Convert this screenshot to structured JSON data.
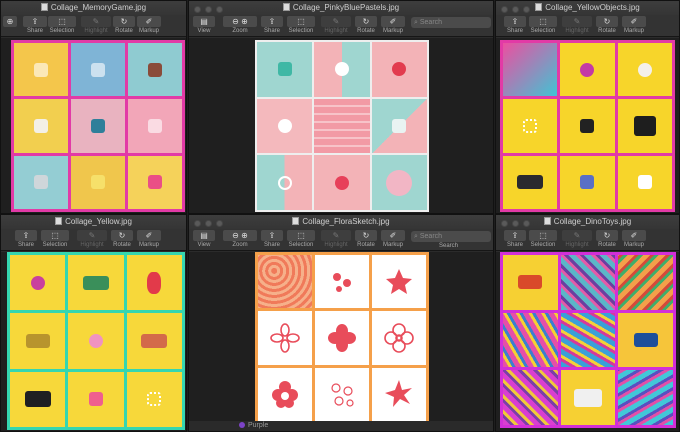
{
  "windows": {
    "memory": {
      "title": "Collage_MemoryGame.jpg"
    },
    "pinky": {
      "title": "Collage_PinkyBluePastels.jpg"
    },
    "yellowobj": {
      "title": "Collage_YellowObjects.jpg"
    },
    "yellow": {
      "title": "Collage_Yellow.jpg"
    },
    "flora": {
      "title": "Collage_FloraSketch.jpg"
    },
    "dino": {
      "title": "Collage_DinoToys.jpg"
    }
  },
  "toolbar": {
    "view": "View",
    "zoom": "Zoom",
    "share": "Share",
    "selection": "Selection",
    "highlight": "Highlight",
    "rotate": "Rotate",
    "markup": "Markup",
    "search_placeholder": "Search",
    "search_label": "Search"
  },
  "statusbar": {
    "text": "Purple"
  },
  "colors": {
    "memory_border": "#e23aa6",
    "yellowobj_border": "#e23aa6",
    "yellow_border": "#35d6b0",
    "flora_border": "#f5a04a",
    "dino_border": "#d22fd8",
    "pinky_border": "#eeeeee",
    "flora_petal": "#e84c5a"
  }
}
